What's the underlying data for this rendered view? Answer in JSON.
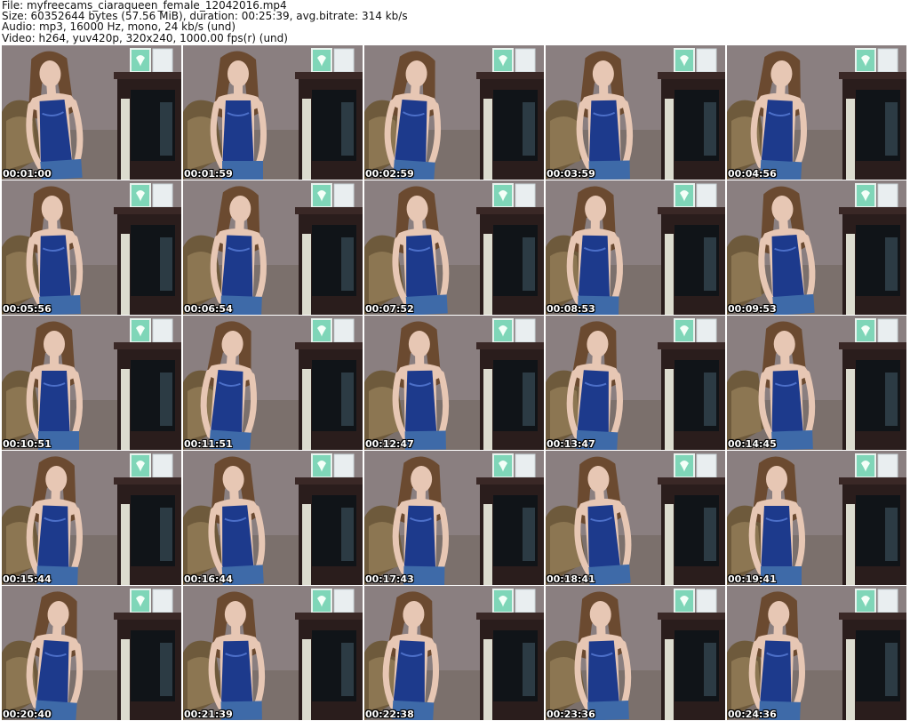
{
  "header": {
    "file_line": "File: myfreecams_ciaraqueen_female_12042016.mp4",
    "size_line": "Size: 60352644 bytes (57.56 MiB), duration: 00:25:39, avg.bitrate: 314 kb/s",
    "audio_line": "Audio: mp3, 16000 Hz, mono, 24 kb/s (und)",
    "video_line": "Video: h264, yuv420p, 320x240, 1000.00 fps(r) (und)"
  },
  "frames": [
    {
      "timestamp": "00:01:00"
    },
    {
      "timestamp": "00:01:59"
    },
    {
      "timestamp": "00:02:59"
    },
    {
      "timestamp": "00:03:59"
    },
    {
      "timestamp": "00:04:56"
    },
    {
      "timestamp": "00:05:56"
    },
    {
      "timestamp": "00:06:54"
    },
    {
      "timestamp": "00:07:52"
    },
    {
      "timestamp": "00:08:53"
    },
    {
      "timestamp": "00:09:53"
    },
    {
      "timestamp": "00:10:51"
    },
    {
      "timestamp": "00:11:51"
    },
    {
      "timestamp": "00:12:47"
    },
    {
      "timestamp": "00:13:47"
    },
    {
      "timestamp": "00:14:45"
    },
    {
      "timestamp": "00:15:44"
    },
    {
      "timestamp": "00:16:44"
    },
    {
      "timestamp": "00:17:43"
    },
    {
      "timestamp": "00:18:41"
    },
    {
      "timestamp": "00:19:41"
    },
    {
      "timestamp": "00:20:40"
    },
    {
      "timestamp": "00:21:39"
    },
    {
      "timestamp": "00:22:38"
    },
    {
      "timestamp": "00:23:36"
    },
    {
      "timestamp": "00:24:36"
    }
  ],
  "colors": {
    "page_background": "#ffffff",
    "wall": "#8a7f80",
    "fireplace": "#2a1d1c",
    "tank_top": "#1d3a8c",
    "hair": "#6b4a30",
    "skin": "#e7c7b4",
    "chair": "#6e5a3c",
    "card": "#7fd6b8",
    "timestamp_text": "#ffffff"
  }
}
